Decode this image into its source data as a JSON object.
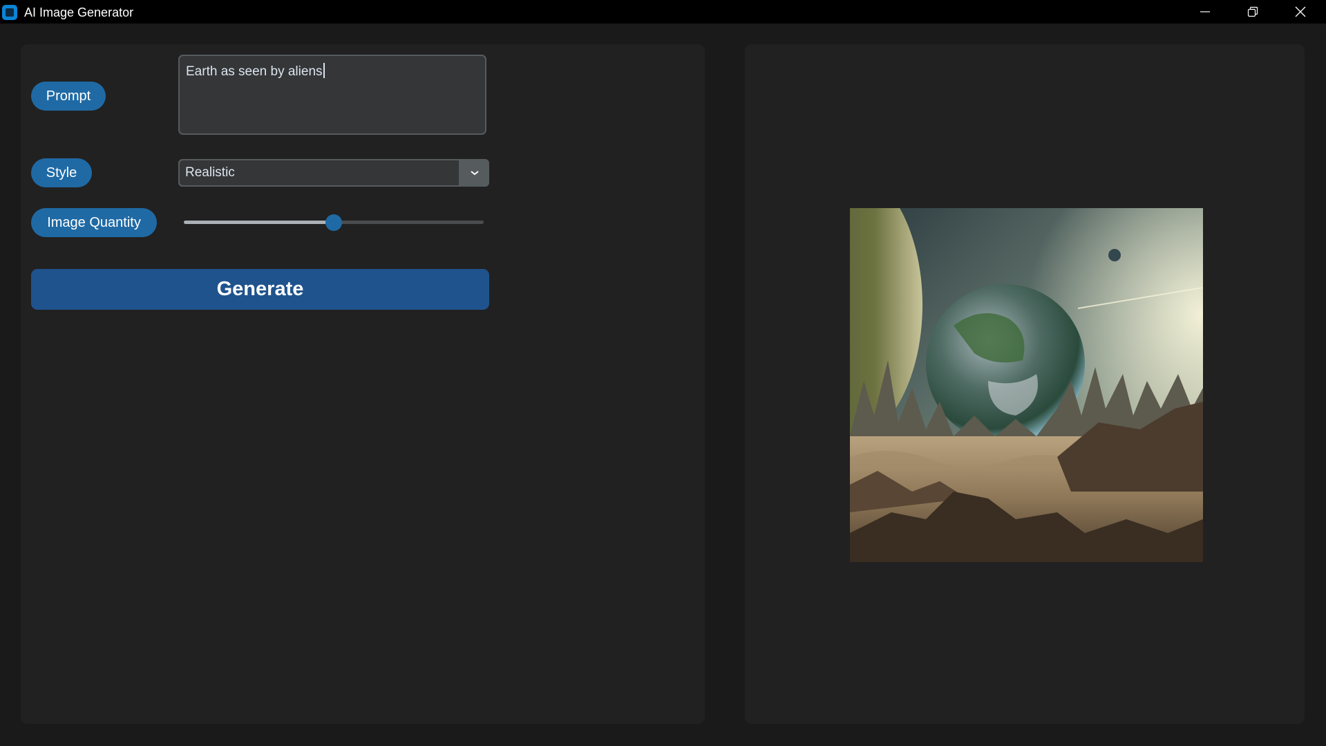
{
  "window": {
    "title": "AI Image Generator"
  },
  "form": {
    "prompt_label": "Prompt",
    "prompt_value": "Earth as seen by aliens",
    "style_label": "Style",
    "style_value": "Realistic",
    "quantity_label": "Image Quantity",
    "quantity_level": 0.5,
    "generate_label": "Generate"
  },
  "theme": {
    "accent": "#1f6aa5",
    "button": "#1f538d",
    "panel": "#212121",
    "background": "#1a1a1a"
  },
  "icons": {
    "app": "app-icon",
    "minimize": "minimize-icon",
    "maximize": "restore-icon",
    "close": "close-icon",
    "dropdown": "chevron-down-icon"
  }
}
